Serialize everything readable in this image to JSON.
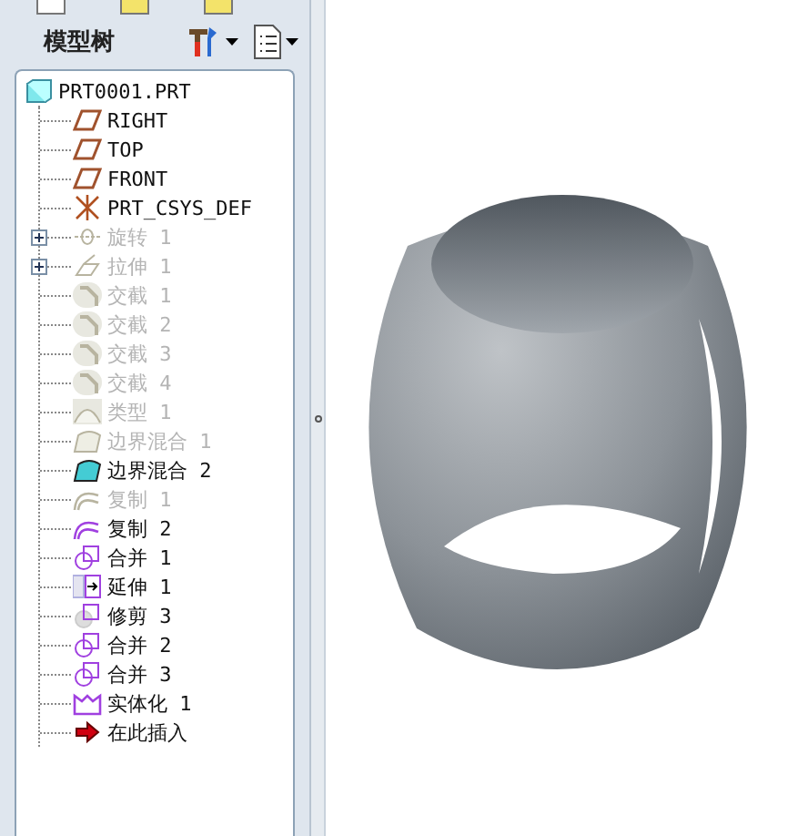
{
  "tabs": [
    {
      "selected": true
    },
    {
      "selected": false
    },
    {
      "selected": false
    }
  ],
  "panel": {
    "title": "模型树"
  },
  "tree": {
    "label": "PRT0001.PRT",
    "kind": "part",
    "children": [
      {
        "label": "RIGHT",
        "kind": "datum-plane",
        "suppressed": false
      },
      {
        "label": "TOP",
        "kind": "datum-plane",
        "suppressed": false
      },
      {
        "label": "FRONT",
        "kind": "datum-plane",
        "suppressed": false
      },
      {
        "label": "PRT_CSYS_DEF",
        "kind": "csys",
        "suppressed": false
      },
      {
        "label": "旋转 1",
        "kind": "revolve",
        "suppressed": true,
        "expanded": false
      },
      {
        "label": "拉伸 1",
        "kind": "extrude",
        "suppressed": true,
        "expanded": false
      },
      {
        "label": "交截 1",
        "kind": "intersect",
        "suppressed": true
      },
      {
        "label": "交截 2",
        "kind": "intersect",
        "suppressed": true
      },
      {
        "label": "交截 3",
        "kind": "intersect",
        "suppressed": true
      },
      {
        "label": "交截 4",
        "kind": "intersect",
        "suppressed": true
      },
      {
        "label": "类型 1",
        "kind": "surface",
        "suppressed": true
      },
      {
        "label": "边界混合 1",
        "kind": "boundary",
        "suppressed": true
      },
      {
        "label": "边界混合 2",
        "kind": "boundary",
        "suppressed": false
      },
      {
        "label": "复制 1",
        "kind": "copy",
        "suppressed": true
      },
      {
        "label": "复制 2",
        "kind": "copy",
        "suppressed": false
      },
      {
        "label": "合并 1",
        "kind": "merge",
        "suppressed": false
      },
      {
        "label": "延伸 1",
        "kind": "extend",
        "suppressed": false
      },
      {
        "label": "修剪 3",
        "kind": "trim",
        "suppressed": false
      },
      {
        "label": "合并 2",
        "kind": "merge",
        "suppressed": false
      },
      {
        "label": "合并 3",
        "kind": "merge",
        "suppressed": false
      },
      {
        "label": "实体化 1",
        "kind": "solidify",
        "suppressed": false
      },
      {
        "label": "在此插入",
        "kind": "insert",
        "suppressed": false
      }
    ]
  }
}
